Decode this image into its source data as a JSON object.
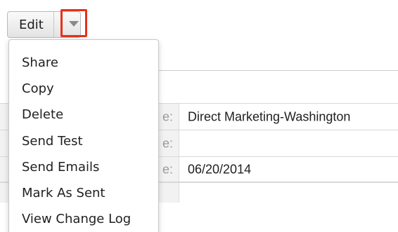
{
  "toolbar": {
    "edit_label": "Edit",
    "dropdown_icon": "caret-down-icon",
    "highlight_color": "#e8301a"
  },
  "menu": {
    "items": [
      {
        "label": "Share"
      },
      {
        "label": "Copy"
      },
      {
        "label": "Delete"
      },
      {
        "label": "Send Test"
      },
      {
        "label": "Send Emails"
      },
      {
        "label": "Mark As Sent"
      },
      {
        "label": "View Change Log"
      }
    ]
  },
  "details": {
    "rows": [
      {
        "label": "e:",
        "value": "Direct Marketing-Washington"
      },
      {
        "label": "e:",
        "value": ""
      },
      {
        "label": "e:",
        "value": "06/20/2014"
      }
    ]
  }
}
